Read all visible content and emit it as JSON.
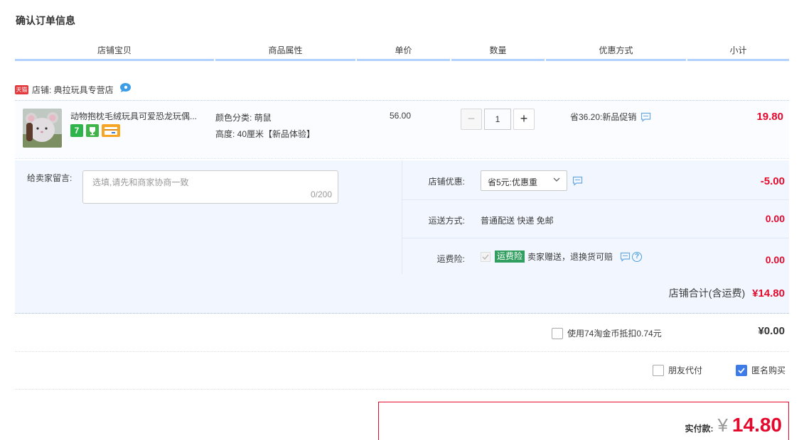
{
  "page_title": "确认订单信息",
  "table_headers": [
    "店铺宝贝",
    "商品属性",
    "单价",
    "数量",
    "优惠方式",
    "小计"
  ],
  "shop": {
    "badge": "天猫",
    "label": "店铺: 典拉玩具专营店"
  },
  "item": {
    "title": "动物抱枕毛绒玩具可爱恐龙玩偶...",
    "tag_7": "7",
    "attr_color": "颜色分类: 萌鼠",
    "attr_height": "高度: 40厘米【新品体验】",
    "unit_price": "56.00",
    "quantity_minus": "−",
    "quantity": "1",
    "quantity_plus": "+",
    "promo": "省36.20:新品促销",
    "subtotal": "19.80"
  },
  "message": {
    "label": "给卖家留言:",
    "placeholder": "选填,请先和商家协商一致",
    "count": "0/200"
  },
  "shop_discount": {
    "label": "店铺优惠:",
    "selected": "省5元:优惠重",
    "amount": "-5.00"
  },
  "shipping": {
    "label": "运送方式:",
    "value": "普通配送 快递 免邮",
    "amount": "0.00"
  },
  "insurance": {
    "label": "运费险:",
    "badge": "运费险",
    "text": "卖家赠送，退换货可赔",
    "help": "?",
    "amount": "0.00"
  },
  "shop_total": {
    "label": "店铺合计(含运费)",
    "amount": "¥14.80"
  },
  "coins": {
    "label": "使用74淘金币抵扣0.74元",
    "amount": "¥0.00",
    "checked": false
  },
  "options": {
    "friend_pay": "朋友代付",
    "friend_checked": false,
    "anonymous": "匿名购买",
    "anonymous_checked": true
  },
  "payment": {
    "label": "实付款:",
    "currency": "¥",
    "amount": "14.80"
  },
  "colors": {
    "accent_red": "#e4092c",
    "header_line": "#b2d1ff",
    "panel_bg": "#f2f7ff",
    "checkbox_blue": "#3d7be8"
  }
}
